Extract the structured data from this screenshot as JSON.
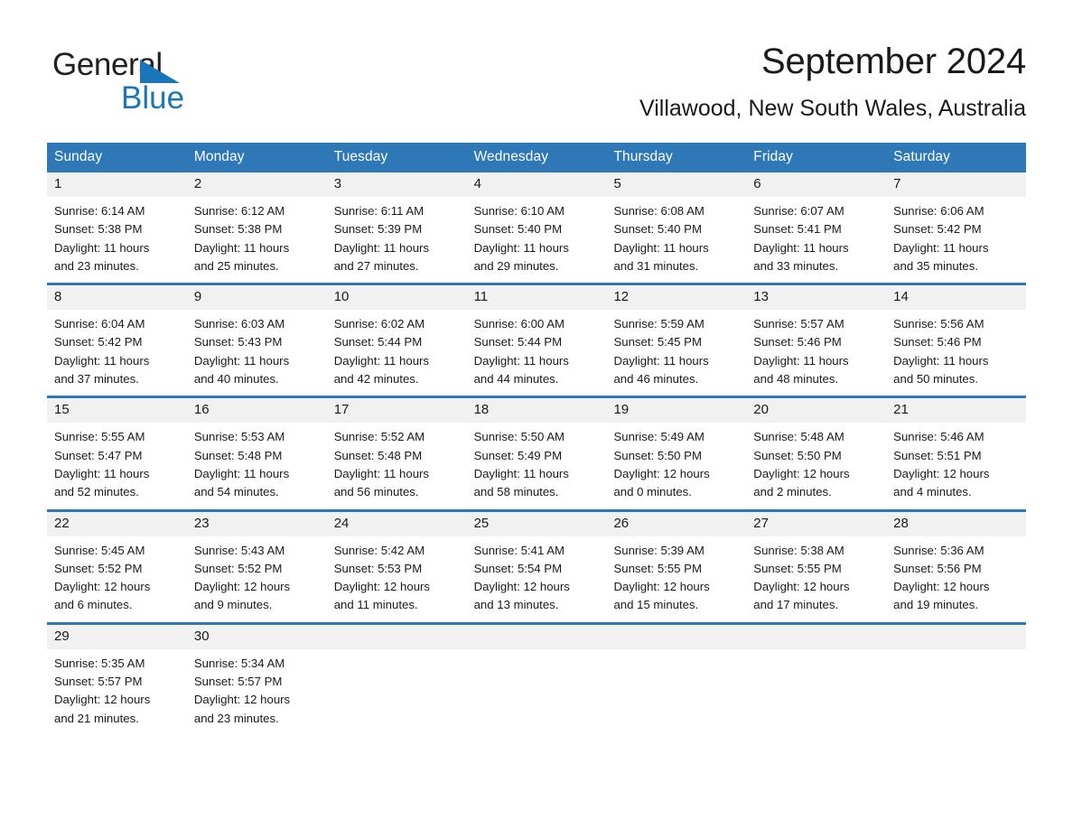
{
  "brand": {
    "name_part1": "General",
    "name_part2": "Blue",
    "triangle_icon": "blue-triangle-logo-mark",
    "accent_color": "#1b75bb"
  },
  "header": {
    "title": "September 2024",
    "location": "Villawood, New South Wales, Australia"
  },
  "theme": {
    "header_bar_color": "#2e78b8",
    "daynum_band_color": "#f1f1f1",
    "separator_color": "#2e78b8",
    "text_color": "#1a1a1a"
  },
  "weekday_headers": [
    "Sunday",
    "Monday",
    "Tuesday",
    "Wednesday",
    "Thursday",
    "Friday",
    "Saturday"
  ],
  "labels": {
    "sunrise": "Sunrise:",
    "sunset": "Sunset:",
    "daylight": "Daylight:"
  },
  "weeks": [
    [
      {
        "day": "1",
        "sunrise": "Sunrise: 6:14 AM",
        "sunset": "Sunset: 5:38 PM",
        "daylight_line1": "Daylight: 11 hours",
        "daylight_line2": "and 23 minutes."
      },
      {
        "day": "2",
        "sunrise": "Sunrise: 6:12 AM",
        "sunset": "Sunset: 5:38 PM",
        "daylight_line1": "Daylight: 11 hours",
        "daylight_line2": "and 25 minutes."
      },
      {
        "day": "3",
        "sunrise": "Sunrise: 6:11 AM",
        "sunset": "Sunset: 5:39 PM",
        "daylight_line1": "Daylight: 11 hours",
        "daylight_line2": "and 27 minutes."
      },
      {
        "day": "4",
        "sunrise": "Sunrise: 6:10 AM",
        "sunset": "Sunset: 5:40 PM",
        "daylight_line1": "Daylight: 11 hours",
        "daylight_line2": "and 29 minutes."
      },
      {
        "day": "5",
        "sunrise": "Sunrise: 6:08 AM",
        "sunset": "Sunset: 5:40 PM",
        "daylight_line1": "Daylight: 11 hours",
        "daylight_line2": "and 31 minutes."
      },
      {
        "day": "6",
        "sunrise": "Sunrise: 6:07 AM",
        "sunset": "Sunset: 5:41 PM",
        "daylight_line1": "Daylight: 11 hours",
        "daylight_line2": "and 33 minutes."
      },
      {
        "day": "7",
        "sunrise": "Sunrise: 6:06 AM",
        "sunset": "Sunset: 5:42 PM",
        "daylight_line1": "Daylight: 11 hours",
        "daylight_line2": "and 35 minutes."
      }
    ],
    [
      {
        "day": "8",
        "sunrise": "Sunrise: 6:04 AM",
        "sunset": "Sunset: 5:42 PM",
        "daylight_line1": "Daylight: 11 hours",
        "daylight_line2": "and 37 minutes."
      },
      {
        "day": "9",
        "sunrise": "Sunrise: 6:03 AM",
        "sunset": "Sunset: 5:43 PM",
        "daylight_line1": "Daylight: 11 hours",
        "daylight_line2": "and 40 minutes."
      },
      {
        "day": "10",
        "sunrise": "Sunrise: 6:02 AM",
        "sunset": "Sunset: 5:44 PM",
        "daylight_line1": "Daylight: 11 hours",
        "daylight_line2": "and 42 minutes."
      },
      {
        "day": "11",
        "sunrise": "Sunrise: 6:00 AM",
        "sunset": "Sunset: 5:44 PM",
        "daylight_line1": "Daylight: 11 hours",
        "daylight_line2": "and 44 minutes."
      },
      {
        "day": "12",
        "sunrise": "Sunrise: 5:59 AM",
        "sunset": "Sunset: 5:45 PM",
        "daylight_line1": "Daylight: 11 hours",
        "daylight_line2": "and 46 minutes."
      },
      {
        "day": "13",
        "sunrise": "Sunrise: 5:57 AM",
        "sunset": "Sunset: 5:46 PM",
        "daylight_line1": "Daylight: 11 hours",
        "daylight_line2": "and 48 minutes."
      },
      {
        "day": "14",
        "sunrise": "Sunrise: 5:56 AM",
        "sunset": "Sunset: 5:46 PM",
        "daylight_line1": "Daylight: 11 hours",
        "daylight_line2": "and 50 minutes."
      }
    ],
    [
      {
        "day": "15",
        "sunrise": "Sunrise: 5:55 AM",
        "sunset": "Sunset: 5:47 PM",
        "daylight_line1": "Daylight: 11 hours",
        "daylight_line2": "and 52 minutes."
      },
      {
        "day": "16",
        "sunrise": "Sunrise: 5:53 AM",
        "sunset": "Sunset: 5:48 PM",
        "daylight_line1": "Daylight: 11 hours",
        "daylight_line2": "and 54 minutes."
      },
      {
        "day": "17",
        "sunrise": "Sunrise: 5:52 AM",
        "sunset": "Sunset: 5:48 PM",
        "daylight_line1": "Daylight: 11 hours",
        "daylight_line2": "and 56 minutes."
      },
      {
        "day": "18",
        "sunrise": "Sunrise: 5:50 AM",
        "sunset": "Sunset: 5:49 PM",
        "daylight_line1": "Daylight: 11 hours",
        "daylight_line2": "and 58 minutes."
      },
      {
        "day": "19",
        "sunrise": "Sunrise: 5:49 AM",
        "sunset": "Sunset: 5:50 PM",
        "daylight_line1": "Daylight: 12 hours",
        "daylight_line2": "and 0 minutes."
      },
      {
        "day": "20",
        "sunrise": "Sunrise: 5:48 AM",
        "sunset": "Sunset: 5:50 PM",
        "daylight_line1": "Daylight: 12 hours",
        "daylight_line2": "and 2 minutes."
      },
      {
        "day": "21",
        "sunrise": "Sunrise: 5:46 AM",
        "sunset": "Sunset: 5:51 PM",
        "daylight_line1": "Daylight: 12 hours",
        "daylight_line2": "and 4 minutes."
      }
    ],
    [
      {
        "day": "22",
        "sunrise": "Sunrise: 5:45 AM",
        "sunset": "Sunset: 5:52 PM",
        "daylight_line1": "Daylight: 12 hours",
        "daylight_line2": "and 6 minutes."
      },
      {
        "day": "23",
        "sunrise": "Sunrise: 5:43 AM",
        "sunset": "Sunset: 5:52 PM",
        "daylight_line1": "Daylight: 12 hours",
        "daylight_line2": "and 9 minutes."
      },
      {
        "day": "24",
        "sunrise": "Sunrise: 5:42 AM",
        "sunset": "Sunset: 5:53 PM",
        "daylight_line1": "Daylight: 12 hours",
        "daylight_line2": "and 11 minutes."
      },
      {
        "day": "25",
        "sunrise": "Sunrise: 5:41 AM",
        "sunset": "Sunset: 5:54 PM",
        "daylight_line1": "Daylight: 12 hours",
        "daylight_line2": "and 13 minutes."
      },
      {
        "day": "26",
        "sunrise": "Sunrise: 5:39 AM",
        "sunset": "Sunset: 5:55 PM",
        "daylight_line1": "Daylight: 12 hours",
        "daylight_line2": "and 15 minutes."
      },
      {
        "day": "27",
        "sunrise": "Sunrise: 5:38 AM",
        "sunset": "Sunset: 5:55 PM",
        "daylight_line1": "Daylight: 12 hours",
        "daylight_line2": "and 17 minutes."
      },
      {
        "day": "28",
        "sunrise": "Sunrise: 5:36 AM",
        "sunset": "Sunset: 5:56 PM",
        "daylight_line1": "Daylight: 12 hours",
        "daylight_line2": "and 19 minutes."
      }
    ],
    [
      {
        "day": "29",
        "sunrise": "Sunrise: 5:35 AM",
        "sunset": "Sunset: 5:57 PM",
        "daylight_line1": "Daylight: 12 hours",
        "daylight_line2": "and 21 minutes."
      },
      {
        "day": "30",
        "sunrise": "Sunrise: 5:34 AM",
        "sunset": "Sunset: 5:57 PM",
        "daylight_line1": "Daylight: 12 hours",
        "daylight_line2": "and 23 minutes."
      },
      {
        "day": "",
        "sunrise": "",
        "sunset": "",
        "daylight_line1": "",
        "daylight_line2": ""
      },
      {
        "day": "",
        "sunrise": "",
        "sunset": "",
        "daylight_line1": "",
        "daylight_line2": ""
      },
      {
        "day": "",
        "sunrise": "",
        "sunset": "",
        "daylight_line1": "",
        "daylight_line2": ""
      },
      {
        "day": "",
        "sunrise": "",
        "sunset": "",
        "daylight_line1": "",
        "daylight_line2": ""
      },
      {
        "day": "",
        "sunrise": "",
        "sunset": "",
        "daylight_line1": "",
        "daylight_line2": ""
      }
    ]
  ]
}
